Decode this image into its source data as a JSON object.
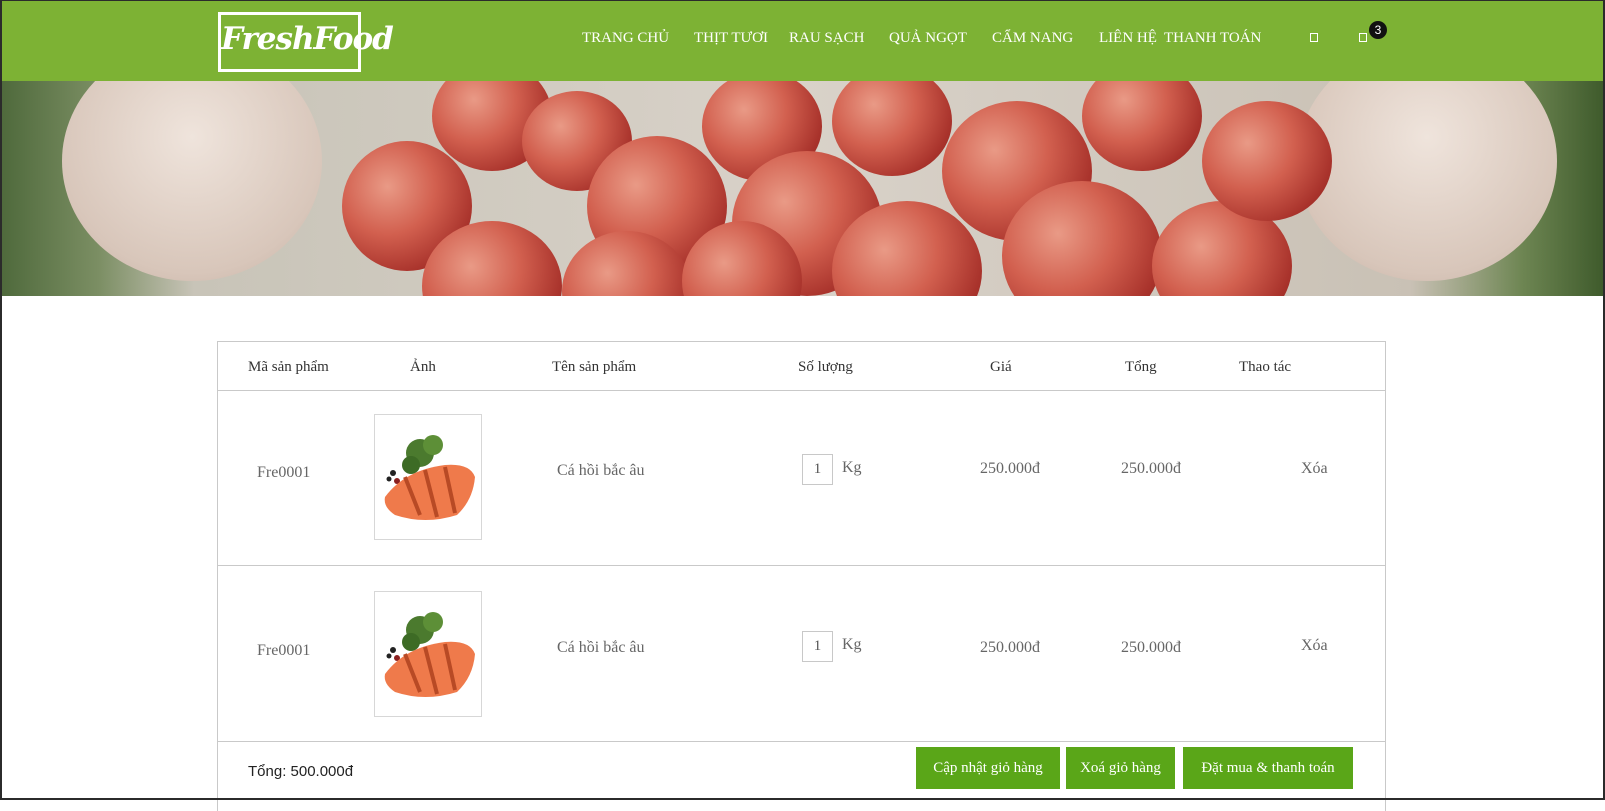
{
  "brand": {
    "logo_text": "FreshFood",
    "accent": "#7db234",
    "button_color": "#5aa618"
  },
  "nav": {
    "items": [
      "TRANG CHỦ",
      "THỊT TƯƠI",
      "RAU SẠCH",
      "QUẢ NGỌT",
      "CẨM NANG",
      "LIÊN HỆ",
      "THANH TOÁN"
    ],
    "icons": [
      "user-icon",
      "cart-icon"
    ],
    "cart_count": "3"
  },
  "cart": {
    "columns": [
      "Mã sản phẩm",
      "Ảnh",
      "Tên sản phẩm",
      "Số lượng",
      "Giá",
      "Tổng",
      "Thao tác"
    ],
    "rows": [
      {
        "code": "Fre0001",
        "name": "Cá hồi bắc âu",
        "qty": "1",
        "unit": "Kg",
        "price": "250.000đ",
        "total": "250.000đ",
        "action": "Xóa"
      },
      {
        "code": "Fre0001",
        "name": "Cá hồi bắc âu",
        "qty": "1",
        "unit": "Kg",
        "price": "250.000đ",
        "total": "250.000đ",
        "action": "Xóa"
      }
    ],
    "grand_total": "Tổng: 500.000đ",
    "buttons": {
      "update": "Cập nhật giỏ hàng",
      "clear": "Xoá giỏ hàng",
      "checkout": "Đặt mua & thanh toán"
    }
  }
}
